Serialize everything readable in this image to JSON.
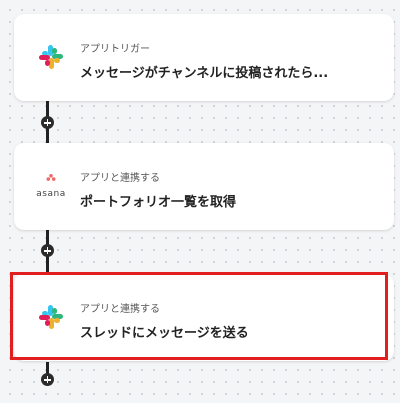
{
  "steps": [
    {
      "subtitle": "アプリトリガー",
      "title": "メッセージがチャンネルに投稿されたら...",
      "icon": "slack-icon"
    },
    {
      "subtitle": "アプリと連携する",
      "title": "ポートフォリオ一覧を取得",
      "icon": "asana-icon",
      "icon_text": "asana"
    },
    {
      "subtitle": "アプリと連携する",
      "title": "スレッドにメッセージを送る",
      "icon": "slack-icon"
    }
  ],
  "colors": {
    "highlight": "#e21f1f",
    "slack_aubergine_blue": "#36C5F0",
    "slack_green": "#2EB67D",
    "slack_yellow": "#ECB22E",
    "slack_red": "#E01E5A",
    "asana_coral": "#F06A6A"
  }
}
